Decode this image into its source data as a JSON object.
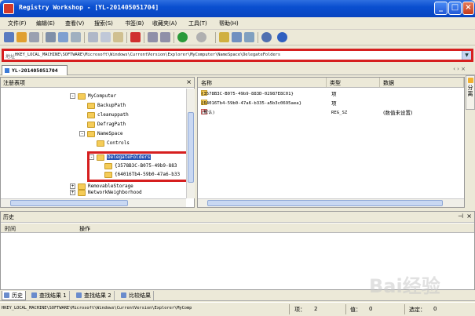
{
  "window": {
    "title": "Registry Workshop - [YL-20140505170​4]"
  },
  "menu": [
    "文件(F)",
    "编辑(E)",
    "查看(V)",
    "搜索(S)",
    "书签(B)",
    "收藏夹(A)",
    "工具(T)",
    "帮助(H)"
  ],
  "address": {
    "label": "地址",
    "value": "HKEY_LOCAL_MACHINE\\SOFTWARE\\Microsoft\\Windows\\CurrentVersion\\Explorer\\MyComputer\\NameSpace\\DelegateFolders"
  },
  "doc_tab": "YL-201405051704",
  "side_tab": "分离",
  "left_pane": {
    "title": "注册表项",
    "tree": [
      {
        "label": "MyComputer",
        "expander": "-"
      },
      {
        "label": "BackupPath",
        "expander": ""
      },
      {
        "label": "cleanuppath",
        "expander": ""
      },
      {
        "label": "DefragPath",
        "expander": ""
      },
      {
        "label": "NameSpace",
        "expander": "-"
      },
      {
        "label": "Controls",
        "expander": ""
      },
      {
        "label": "DelegateFolders",
        "expander": "-"
      },
      {
        "label": "{3578B3C-B075-49b9-883",
        "expander": ""
      },
      {
        "label": "{64016Tb4-59b0-47a6-b33",
        "expander": ""
      },
      {
        "label": "RemovableStorage",
        "expander": "+"
      },
      {
        "label": "NetworkNeighborhood",
        "expander": "+"
      }
    ]
  },
  "right_pane": {
    "columns": [
      "名称",
      "类型",
      "数据"
    ],
    "rows": [
      {
        "name": "{3578B3C-B075-49b9-883D-02987E8C01}",
        "type": "项",
        "data": "",
        "icon": "folder-icon"
      },
      {
        "name": "{64016Tb4-59b0-47a6-b335-a5b3c0695aea}",
        "type": "项",
        "data": "",
        "icon": "folder-icon"
      },
      {
        "name": "(默认)",
        "type": "REG_SZ",
        "data": "(数值未设置)",
        "icon": "string-value-icon"
      }
    ]
  },
  "history": {
    "title": "历史",
    "columns": [
      "时间",
      "操作"
    ]
  },
  "bottom_tabs": [
    "历史",
    "查找结果 1",
    "查找结果 2",
    "比较结果"
  ],
  "status": {
    "path": "HKEY_LOCAL_MACHINE\\SOFTWARE\\Microsoft\\Windows\\CurrentVersion\\Explorer\\MyComp",
    "items_label": "项：",
    "items_value": "2",
    "values_label": "值：",
    "values_value": "0",
    "selected_label": "选定：",
    "selected_value": "0"
  },
  "watermark": "Bai经验",
  "colors": {
    "titlebar": "#0a4fd0",
    "highlight": "#d61f1f",
    "selection": "#2753b4"
  }
}
